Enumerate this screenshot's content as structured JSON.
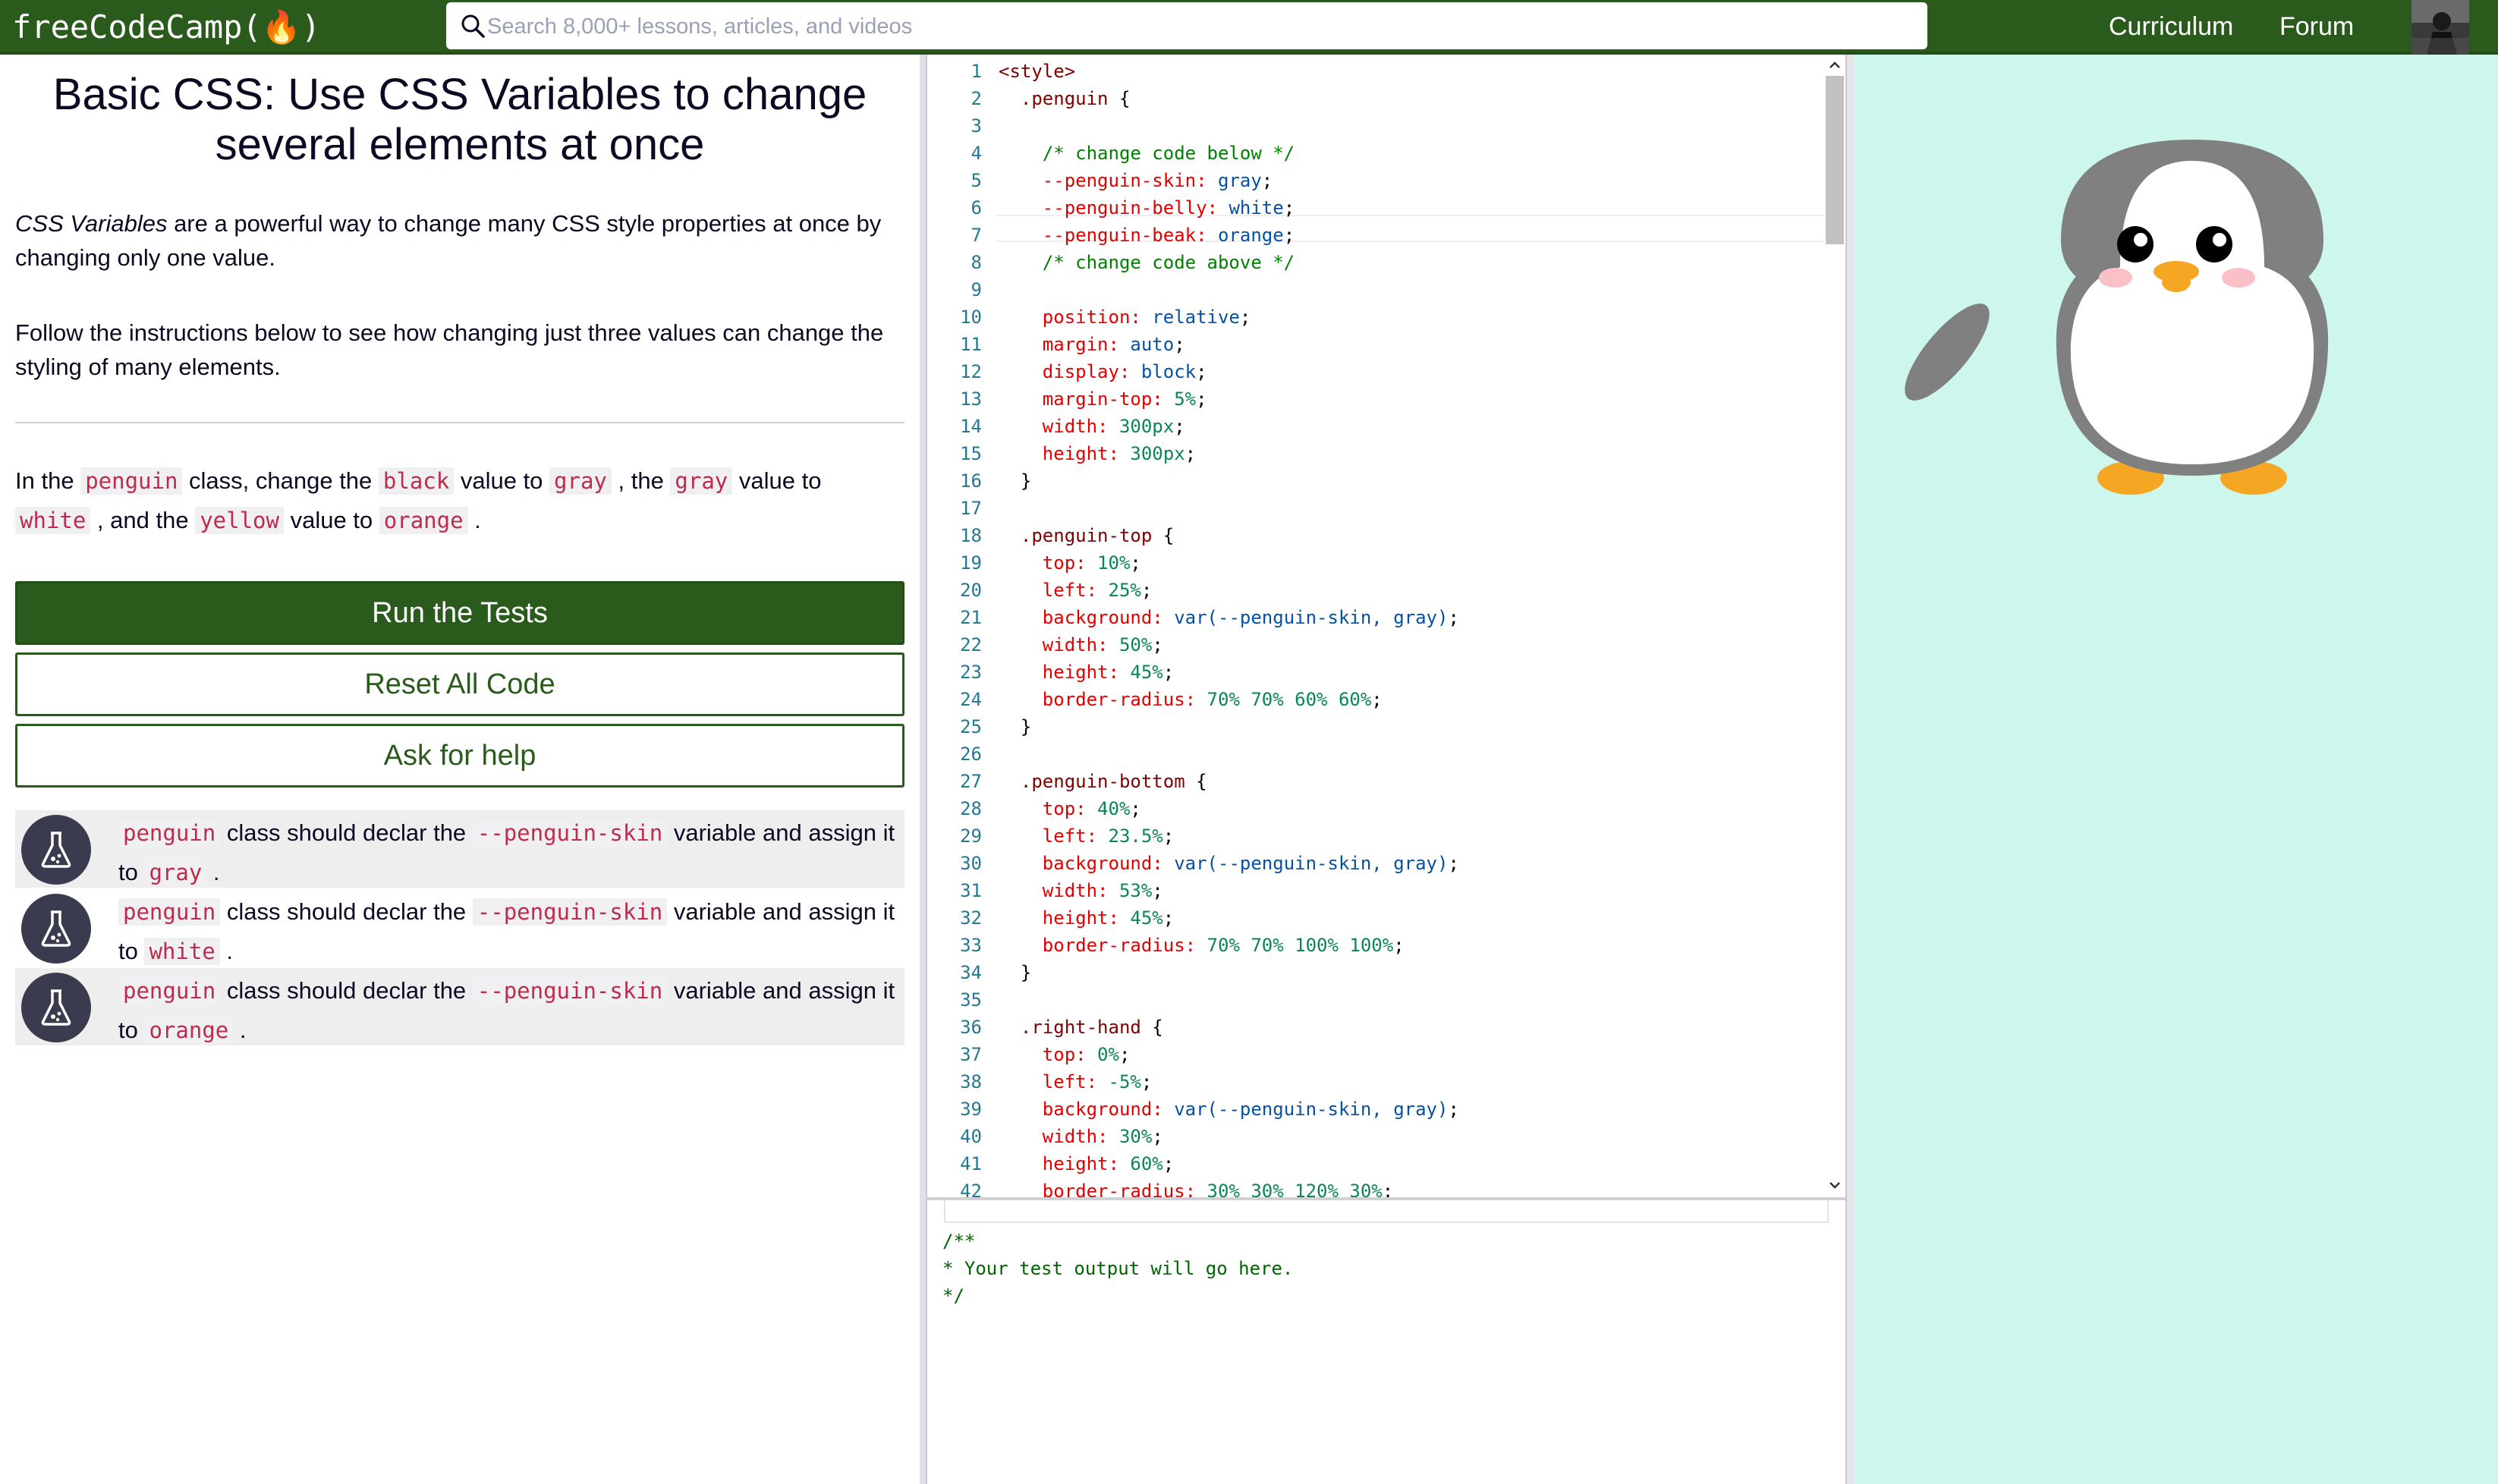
{
  "navbar": {
    "logo": "freeCodeCamp(🔥)",
    "search_placeholder": "Search 8,000+ lessons, articles, and videos",
    "links": [
      "Curriculum",
      "Forum"
    ]
  },
  "challenge": {
    "title": "Basic CSS: Use CSS Variables to change several elements at once",
    "intro_em": "CSS Variables",
    "intro_rest": " are a powerful way to change many CSS style properties at once by changing only one value.",
    "follow": "Follow the instructions below to see how changing just three values can change the styling of many elements.",
    "instr": {
      "t1": "In the ",
      "c1": "penguin",
      "t2": " class, change the ",
      "c2": "black",
      "t3": " value to ",
      "c3": "gray",
      "t4": " , the ",
      "c4": "gray",
      "t5": " value to ",
      "c5": "white",
      "t6": " , and the ",
      "c6": "yellow",
      "t7": " value to ",
      "c7": "orange",
      "t8": " ."
    },
    "buttons": {
      "run": "Run the Tests",
      "reset": "Reset All Code",
      "help": "Ask for help"
    },
    "tests": [
      {
        "code1": "penguin",
        "text1": " class should declar the ",
        "code2": "--penguin-skin",
        "text2": " variable and assign it to ",
        "code3": "gray",
        "text3": " ."
      },
      {
        "code1": "penguin",
        "text1": " class should declar the ",
        "code2": "--penguin-skin",
        "text2": " variable and assign it to ",
        "code3": "white",
        "text3": " ."
      },
      {
        "code1": "penguin",
        "text1": " class should declar the ",
        "code2": "--penguin-skin",
        "text2": " variable and assign it to ",
        "code3": "orange",
        "text3": " ."
      }
    ]
  },
  "editor": {
    "lines": [
      [
        [
          "tag",
          "<style>"
        ]
      ],
      [
        [
          "pl",
          "  "
        ],
        [
          "sel",
          ".penguin"
        ],
        [
          "pl",
          " {"
        ]
      ],
      [],
      [
        [
          "pl",
          "    "
        ],
        [
          "cm",
          "/* change code below */"
        ]
      ],
      [
        [
          "pl",
          "    "
        ],
        [
          "prop",
          "--penguin-skin:"
        ],
        [
          "pl",
          " "
        ],
        [
          "val",
          "gray"
        ],
        [
          "pl",
          ";"
        ]
      ],
      [
        [
          "pl",
          "    "
        ],
        [
          "prop",
          "--penguin-belly:"
        ],
        [
          "pl",
          " "
        ],
        [
          "val",
          "white"
        ],
        [
          "pl",
          ";"
        ]
      ],
      [
        [
          "pl",
          "    "
        ],
        [
          "prop",
          "--penguin-beak:"
        ],
        [
          "pl",
          " "
        ],
        [
          "val",
          "orange"
        ],
        [
          "pl",
          ";"
        ]
      ],
      [
        [
          "pl",
          "    "
        ],
        [
          "cm",
          "/* change code above */"
        ]
      ],
      [],
      [
        [
          "pl",
          "    "
        ],
        [
          "prop",
          "position:"
        ],
        [
          "pl",
          " "
        ],
        [
          "val",
          "relative"
        ],
        [
          "pl",
          ";"
        ]
      ],
      [
        [
          "pl",
          "    "
        ],
        [
          "prop",
          "margin:"
        ],
        [
          "pl",
          " "
        ],
        [
          "val",
          "auto"
        ],
        [
          "pl",
          ";"
        ]
      ],
      [
        [
          "pl",
          "    "
        ],
        [
          "prop",
          "display:"
        ],
        [
          "pl",
          " "
        ],
        [
          "val",
          "block"
        ],
        [
          "pl",
          ";"
        ]
      ],
      [
        [
          "pl",
          "    "
        ],
        [
          "prop",
          "margin-top:"
        ],
        [
          "pl",
          " "
        ],
        [
          "num",
          "5%"
        ],
        [
          "pl",
          ";"
        ]
      ],
      [
        [
          "pl",
          "    "
        ],
        [
          "prop",
          "width:"
        ],
        [
          "pl",
          " "
        ],
        [
          "num",
          "300px"
        ],
        [
          "pl",
          ";"
        ]
      ],
      [
        [
          "pl",
          "    "
        ],
        [
          "prop",
          "height:"
        ],
        [
          "pl",
          " "
        ],
        [
          "num",
          "300px"
        ],
        [
          "pl",
          ";"
        ]
      ],
      [
        [
          "pl",
          "  }"
        ]
      ],
      [],
      [
        [
          "pl",
          "  "
        ],
        [
          "sel",
          ".penguin-top"
        ],
        [
          "pl",
          " {"
        ]
      ],
      [
        [
          "pl",
          "    "
        ],
        [
          "prop",
          "top:"
        ],
        [
          "pl",
          " "
        ],
        [
          "num",
          "10%"
        ],
        [
          "pl",
          ";"
        ]
      ],
      [
        [
          "pl",
          "    "
        ],
        [
          "prop",
          "left:"
        ],
        [
          "pl",
          " "
        ],
        [
          "num",
          "25%"
        ],
        [
          "pl",
          ";"
        ]
      ],
      [
        [
          "pl",
          "    "
        ],
        [
          "prop",
          "background:"
        ],
        [
          "pl",
          " "
        ],
        [
          "val",
          "var(--penguin-skin, gray)"
        ],
        [
          "pl",
          ";"
        ]
      ],
      [
        [
          "pl",
          "    "
        ],
        [
          "prop",
          "width:"
        ],
        [
          "pl",
          " "
        ],
        [
          "num",
          "50%"
        ],
        [
          "pl",
          ";"
        ]
      ],
      [
        [
          "pl",
          "    "
        ],
        [
          "prop",
          "height:"
        ],
        [
          "pl",
          " "
        ],
        [
          "num",
          "45%"
        ],
        [
          "pl",
          ";"
        ]
      ],
      [
        [
          "pl",
          "    "
        ],
        [
          "prop",
          "border-radius:"
        ],
        [
          "pl",
          " "
        ],
        [
          "num",
          "70% 70% 60% 60%"
        ],
        [
          "pl",
          ";"
        ]
      ],
      [
        [
          "pl",
          "  }"
        ]
      ],
      [],
      [
        [
          "pl",
          "  "
        ],
        [
          "sel",
          ".penguin-bottom"
        ],
        [
          "pl",
          " {"
        ]
      ],
      [
        [
          "pl",
          "    "
        ],
        [
          "prop",
          "top:"
        ],
        [
          "pl",
          " "
        ],
        [
          "num",
          "40%"
        ],
        [
          "pl",
          ";"
        ]
      ],
      [
        [
          "pl",
          "    "
        ],
        [
          "prop",
          "left:"
        ],
        [
          "pl",
          " "
        ],
        [
          "num",
          "23.5%"
        ],
        [
          "pl",
          ";"
        ]
      ],
      [
        [
          "pl",
          "    "
        ],
        [
          "prop",
          "background:"
        ],
        [
          "pl",
          " "
        ],
        [
          "val",
          "var(--penguin-skin, gray)"
        ],
        [
          "pl",
          ";"
        ]
      ],
      [
        [
          "pl",
          "    "
        ],
        [
          "prop",
          "width:"
        ],
        [
          "pl",
          " "
        ],
        [
          "num",
          "53%"
        ],
        [
          "pl",
          ";"
        ]
      ],
      [
        [
          "pl",
          "    "
        ],
        [
          "prop",
          "height:"
        ],
        [
          "pl",
          " "
        ],
        [
          "num",
          "45%"
        ],
        [
          "pl",
          ";"
        ]
      ],
      [
        [
          "pl",
          "    "
        ],
        [
          "prop",
          "border-radius:"
        ],
        [
          "pl",
          " "
        ],
        [
          "num",
          "70% 70% 100% 100%"
        ],
        [
          "pl",
          ";"
        ]
      ],
      [
        [
          "pl",
          "  }"
        ]
      ],
      [],
      [
        [
          "pl",
          "  "
        ],
        [
          "sel",
          ".right-hand"
        ],
        [
          "pl",
          " {"
        ]
      ],
      [
        [
          "pl",
          "    "
        ],
        [
          "prop",
          "top:"
        ],
        [
          "pl",
          " "
        ],
        [
          "num",
          "0%"
        ],
        [
          "pl",
          ";"
        ]
      ],
      [
        [
          "pl",
          "    "
        ],
        [
          "prop",
          "left:"
        ],
        [
          "pl",
          " "
        ],
        [
          "num",
          "-5%"
        ],
        [
          "pl",
          ";"
        ]
      ],
      [
        [
          "pl",
          "    "
        ],
        [
          "prop",
          "background:"
        ],
        [
          "pl",
          " "
        ],
        [
          "val",
          "var(--penguin-skin, gray)"
        ],
        [
          "pl",
          ";"
        ]
      ],
      [
        [
          "pl",
          "    "
        ],
        [
          "prop",
          "width:"
        ],
        [
          "pl",
          " "
        ],
        [
          "num",
          "30%"
        ],
        [
          "pl",
          ";"
        ]
      ],
      [
        [
          "pl",
          "    "
        ],
        [
          "prop",
          "height:"
        ],
        [
          "pl",
          " "
        ],
        [
          "num",
          "60%"
        ],
        [
          "pl",
          ";"
        ]
      ],
      [
        [
          "pl",
          "    "
        ],
        [
          "prop",
          "border-radius:"
        ],
        [
          "pl",
          " "
        ],
        [
          "num",
          "30% 30% 120% 30%"
        ],
        [
          "pl",
          ";"
        ]
      ]
    ]
  },
  "output": {
    "text": "/**\n* Your test output will go here.\n*/"
  },
  "preview": {
    "colors": {
      "background": "#cdf6ec",
      "skin": "#808080",
      "belly": "#ffffff",
      "beak": "#f5a623",
      "feet": "#f5a623",
      "cheeks": "#f9c0c8"
    }
  }
}
